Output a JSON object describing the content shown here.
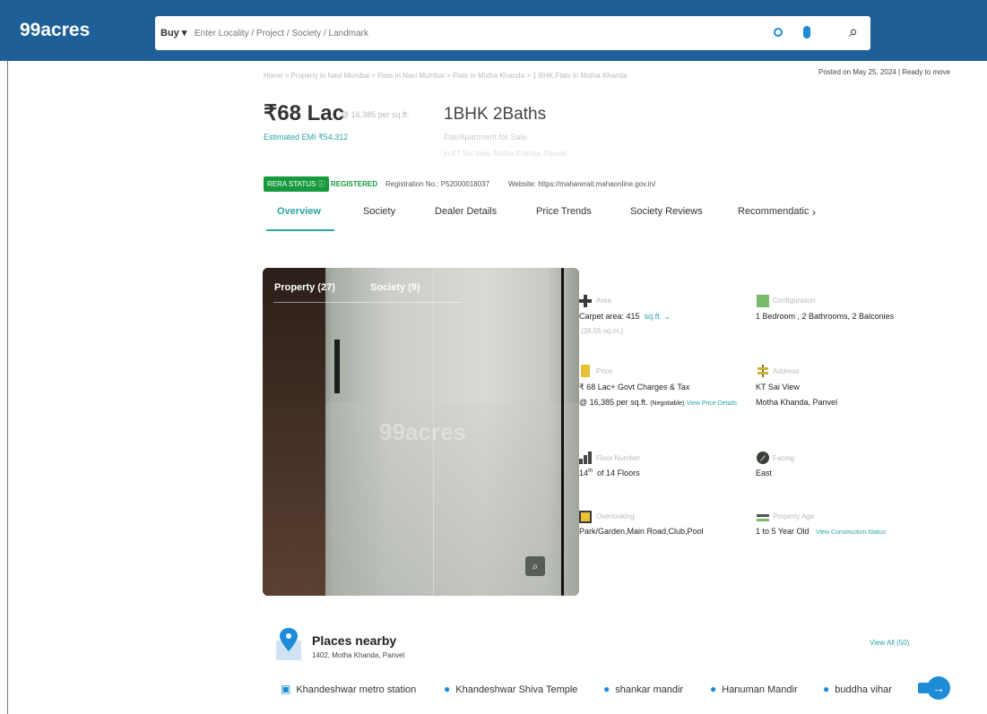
{
  "header": {
    "logo": "99acres",
    "buy_label": "Buy",
    "search_placeholder": "Enter Locality / Project / Society / Landmark"
  },
  "breadcrumb": "Home > Property in Navi Mumbai > Flats in Navi Mumbai > Flats in Motha Khanda > 1 BHK Flats in Motha Khanda",
  "posted": "Posted on May 25, 2024  |  Ready to move",
  "listing": {
    "price_symbol": "₹",
    "price": "68 Lac",
    "price_per_sqft": "@ 16,385 per sq.ft.",
    "emi": "Estimated EMI ₹54,312",
    "bhk": "1BHK 2Baths",
    "type": "Flat/Apartment for Sale",
    "subline": "in KT Sai View, Motha Khanda, Panvel"
  },
  "rera": {
    "status_label": "RERA STATUS",
    "registered": "REGISTERED",
    "registration_no": "Registration No.: P52000018037",
    "website": "Website: https://maharerait.mahaonline.gov.in/"
  },
  "tabs": [
    "Overview",
    "Society",
    "Dealer Details",
    "Price Trends",
    "Society Reviews",
    "Recommendatic"
  ],
  "photo": {
    "tab_property": "Property (27)",
    "tab_society": "Society (9)",
    "watermark": "99acres"
  },
  "features": [
    {
      "label": "Area",
      "value": "Carpet area: 415",
      "unit": "sq.ft.",
      "extra": "(38.55 sq.m.)"
    },
    {
      "label": "Configuration",
      "value": "1 Bedroom , 2 Bathrooms, 2 Balconies"
    },
    {
      "label": "Price",
      "value": "₹ 68 Lac+ Govt Charges & Tax",
      "value2": "@ 16,385 per sq.ft.",
      "neg": "(Negotiable)",
      "link": "View Price Details"
    },
    {
      "label": "Address",
      "value": "KT Sai View",
      "value2": "Motha Khanda, Panvel"
    },
    {
      "label": "Floor Number",
      "value": "14",
      "sup": "th",
      "value2": "of 14 Floors"
    },
    {
      "label": "Facing",
      "value": "East"
    },
    {
      "label": "Overlooking",
      "value": "Park/Garden,Main Road,Club,Pool"
    },
    {
      "label": "Property Age",
      "value": "1 to 5 Year Old",
      "link": "View Construction Status"
    }
  ],
  "places": {
    "title": "Places nearby",
    "subtitle": "1402, Motha Khanda, Panvel",
    "view_all": "View All (50)",
    "items": [
      "Khandeshwar metro station",
      "Khandeshwar Shiva Temple",
      "shankar mandir",
      "Hanuman Mandir",
      "buddha vihar"
    ]
  },
  "colors": {
    "header": "#1d5f96",
    "accent": "#2aa5a5",
    "rera_green": "#169a3d",
    "pin_blue": "#1d8bd8"
  }
}
